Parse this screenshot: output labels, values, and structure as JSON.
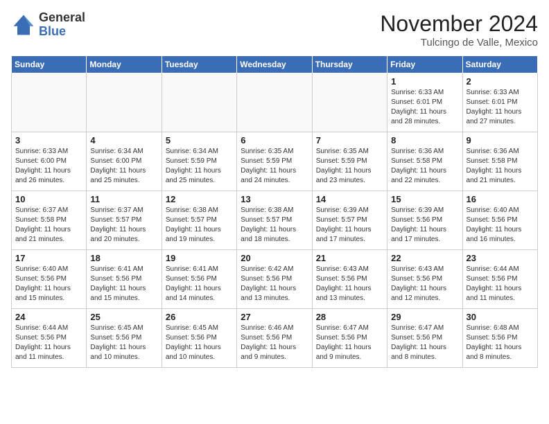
{
  "logo": {
    "general": "General",
    "blue": "Blue"
  },
  "header": {
    "month_year": "November 2024",
    "location": "Tulcingo de Valle, Mexico"
  },
  "weekdays": [
    "Sunday",
    "Monday",
    "Tuesday",
    "Wednesday",
    "Thursday",
    "Friday",
    "Saturday"
  ],
  "weeks": [
    [
      {
        "day": "",
        "info": ""
      },
      {
        "day": "",
        "info": ""
      },
      {
        "day": "",
        "info": ""
      },
      {
        "day": "",
        "info": ""
      },
      {
        "day": "",
        "info": ""
      },
      {
        "day": "1",
        "info": "Sunrise: 6:33 AM\nSunset: 6:01 PM\nDaylight: 11 hours\nand 28 minutes."
      },
      {
        "day": "2",
        "info": "Sunrise: 6:33 AM\nSunset: 6:01 PM\nDaylight: 11 hours\nand 27 minutes."
      }
    ],
    [
      {
        "day": "3",
        "info": "Sunrise: 6:33 AM\nSunset: 6:00 PM\nDaylight: 11 hours\nand 26 minutes."
      },
      {
        "day": "4",
        "info": "Sunrise: 6:34 AM\nSunset: 6:00 PM\nDaylight: 11 hours\nand 25 minutes."
      },
      {
        "day": "5",
        "info": "Sunrise: 6:34 AM\nSunset: 5:59 PM\nDaylight: 11 hours\nand 25 minutes."
      },
      {
        "day": "6",
        "info": "Sunrise: 6:35 AM\nSunset: 5:59 PM\nDaylight: 11 hours\nand 24 minutes."
      },
      {
        "day": "7",
        "info": "Sunrise: 6:35 AM\nSunset: 5:59 PM\nDaylight: 11 hours\nand 23 minutes."
      },
      {
        "day": "8",
        "info": "Sunrise: 6:36 AM\nSunset: 5:58 PM\nDaylight: 11 hours\nand 22 minutes."
      },
      {
        "day": "9",
        "info": "Sunrise: 6:36 AM\nSunset: 5:58 PM\nDaylight: 11 hours\nand 21 minutes."
      }
    ],
    [
      {
        "day": "10",
        "info": "Sunrise: 6:37 AM\nSunset: 5:58 PM\nDaylight: 11 hours\nand 21 minutes."
      },
      {
        "day": "11",
        "info": "Sunrise: 6:37 AM\nSunset: 5:57 PM\nDaylight: 11 hours\nand 20 minutes."
      },
      {
        "day": "12",
        "info": "Sunrise: 6:38 AM\nSunset: 5:57 PM\nDaylight: 11 hours\nand 19 minutes."
      },
      {
        "day": "13",
        "info": "Sunrise: 6:38 AM\nSunset: 5:57 PM\nDaylight: 11 hours\nand 18 minutes."
      },
      {
        "day": "14",
        "info": "Sunrise: 6:39 AM\nSunset: 5:57 PM\nDaylight: 11 hours\nand 17 minutes."
      },
      {
        "day": "15",
        "info": "Sunrise: 6:39 AM\nSunset: 5:56 PM\nDaylight: 11 hours\nand 17 minutes."
      },
      {
        "day": "16",
        "info": "Sunrise: 6:40 AM\nSunset: 5:56 PM\nDaylight: 11 hours\nand 16 minutes."
      }
    ],
    [
      {
        "day": "17",
        "info": "Sunrise: 6:40 AM\nSunset: 5:56 PM\nDaylight: 11 hours\nand 15 minutes."
      },
      {
        "day": "18",
        "info": "Sunrise: 6:41 AM\nSunset: 5:56 PM\nDaylight: 11 hours\nand 15 minutes."
      },
      {
        "day": "19",
        "info": "Sunrise: 6:41 AM\nSunset: 5:56 PM\nDaylight: 11 hours\nand 14 minutes."
      },
      {
        "day": "20",
        "info": "Sunrise: 6:42 AM\nSunset: 5:56 PM\nDaylight: 11 hours\nand 13 minutes."
      },
      {
        "day": "21",
        "info": "Sunrise: 6:43 AM\nSunset: 5:56 PM\nDaylight: 11 hours\nand 13 minutes."
      },
      {
        "day": "22",
        "info": "Sunrise: 6:43 AM\nSunset: 5:56 PM\nDaylight: 11 hours\nand 12 minutes."
      },
      {
        "day": "23",
        "info": "Sunrise: 6:44 AM\nSunset: 5:56 PM\nDaylight: 11 hours\nand 11 minutes."
      }
    ],
    [
      {
        "day": "24",
        "info": "Sunrise: 6:44 AM\nSunset: 5:56 PM\nDaylight: 11 hours\nand 11 minutes."
      },
      {
        "day": "25",
        "info": "Sunrise: 6:45 AM\nSunset: 5:56 PM\nDaylight: 11 hours\nand 10 minutes."
      },
      {
        "day": "26",
        "info": "Sunrise: 6:45 AM\nSunset: 5:56 PM\nDaylight: 11 hours\nand 10 minutes."
      },
      {
        "day": "27",
        "info": "Sunrise: 6:46 AM\nSunset: 5:56 PM\nDaylight: 11 hours\nand 9 minutes."
      },
      {
        "day": "28",
        "info": "Sunrise: 6:47 AM\nSunset: 5:56 PM\nDaylight: 11 hours\nand 9 minutes."
      },
      {
        "day": "29",
        "info": "Sunrise: 6:47 AM\nSunset: 5:56 PM\nDaylight: 11 hours\nand 8 minutes."
      },
      {
        "day": "30",
        "info": "Sunrise: 6:48 AM\nSunset: 5:56 PM\nDaylight: 11 hours\nand 8 minutes."
      }
    ]
  ]
}
